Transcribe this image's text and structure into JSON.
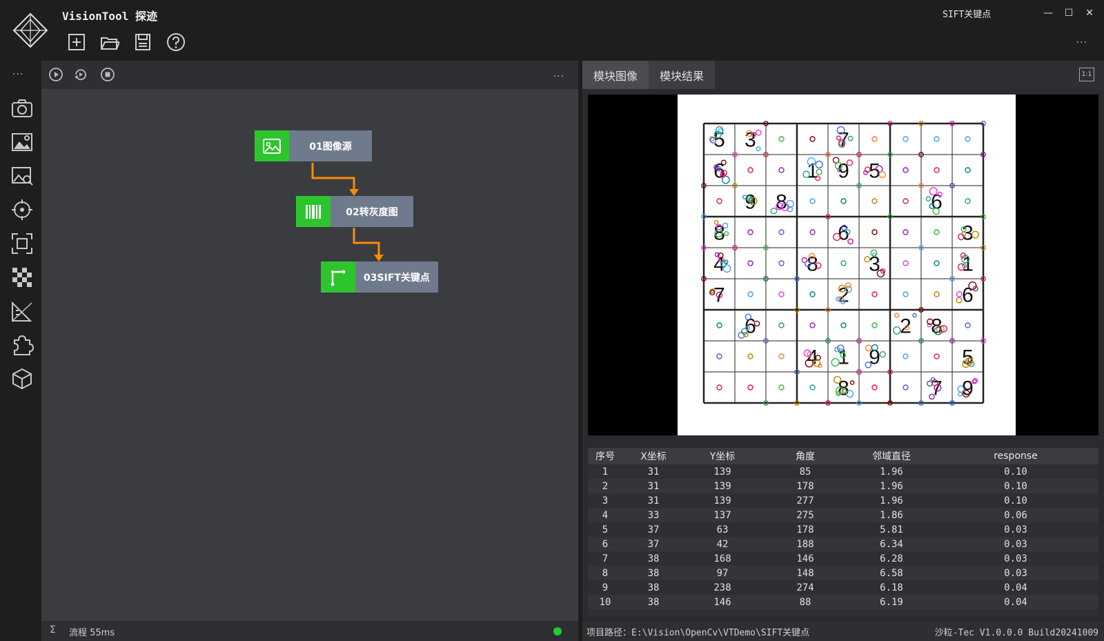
{
  "app": {
    "title": "VisionTool 探迹",
    "window_title": "SIFT关键点",
    "more": "..."
  },
  "window_controls": {
    "minimize": "—",
    "maximize": "☐",
    "close": "✕"
  },
  "toolbar": {
    "icons": [
      "new-icon",
      "open-folder-icon",
      "save-icon",
      "help-icon"
    ]
  },
  "leftbar": {
    "more": "...",
    "icons": [
      "camera-icon",
      "image-settings-icon",
      "image-search-icon",
      "target-icon",
      "focus-frame-icon",
      "checker-icon",
      "ruler-icon",
      "puzzle-icon",
      "cube-icon"
    ]
  },
  "flow": {
    "toolbar_more": "...",
    "nodes": [
      {
        "label": "01图像源",
        "icon": "image-icon"
      },
      {
        "label": "02转灰度图",
        "icon": "barcode-icon"
      },
      {
        "label": "03SIFT关键点",
        "icon": "polyline-icon"
      }
    ]
  },
  "tabs": [
    {
      "label": "模块图像",
      "active": true
    },
    {
      "label": "模块结果",
      "active": false
    }
  ],
  "fit_label": "1:1",
  "sudoku": {
    "digits": [
      [
        5,
        3,
        0,
        0,
        7,
        0,
        0,
        0,
        0
      ],
      [
        6,
        0,
        0,
        1,
        9,
        5,
        0,
        0,
        0
      ],
      [
        0,
        9,
        8,
        0,
        0,
        0,
        0,
        6,
        0
      ],
      [
        8,
        0,
        0,
        0,
        6,
        0,
        0,
        0,
        3
      ],
      [
        4,
        0,
        0,
        8,
        0,
        3,
        0,
        0,
        1
      ],
      [
        7,
        0,
        0,
        0,
        2,
        0,
        0,
        0,
        6
      ],
      [
        0,
        6,
        0,
        0,
        0,
        0,
        2,
        8,
        0
      ],
      [
        0,
        0,
        0,
        4,
        1,
        9,
        0,
        0,
        5
      ],
      [
        0,
        0,
        0,
        0,
        8,
        0,
        0,
        7,
        9
      ]
    ]
  },
  "results": {
    "columns": [
      "序号",
      "X坐标",
      "Y坐标",
      "角度",
      "邻域直径",
      "response"
    ],
    "rows": [
      [
        "1",
        "31",
        "139",
        "85",
        "1.96",
        "0.10"
      ],
      [
        "2",
        "31",
        "139",
        "178",
        "1.96",
        "0.10"
      ],
      [
        "3",
        "31",
        "139",
        "277",
        "1.96",
        "0.10"
      ],
      [
        "4",
        "33",
        "137",
        "275",
        "1.86",
        "0.06"
      ],
      [
        "5",
        "37",
        "63",
        "178",
        "5.81",
        "0.03"
      ],
      [
        "6",
        "37",
        "42",
        "188",
        "6.34",
        "0.03"
      ],
      [
        "7",
        "38",
        "168",
        "146",
        "6.28",
        "0.03"
      ],
      [
        "8",
        "38",
        "97",
        "148",
        "6.58",
        "0.03"
      ],
      [
        "9",
        "38",
        "238",
        "274",
        "6.18",
        "0.04"
      ],
      [
        "10",
        "38",
        "146",
        "88",
        "6.19",
        "0.04"
      ]
    ]
  },
  "status": {
    "sigma": "Σ",
    "flow_time": "流程 55ms",
    "dot_color": "#22cc33",
    "project_path": "项目路径：E:\\Vision\\OpenCv\\VTDemo\\SIFT关键点",
    "version": "沙粒-Tec V1.0.0.0 Build20241009"
  }
}
